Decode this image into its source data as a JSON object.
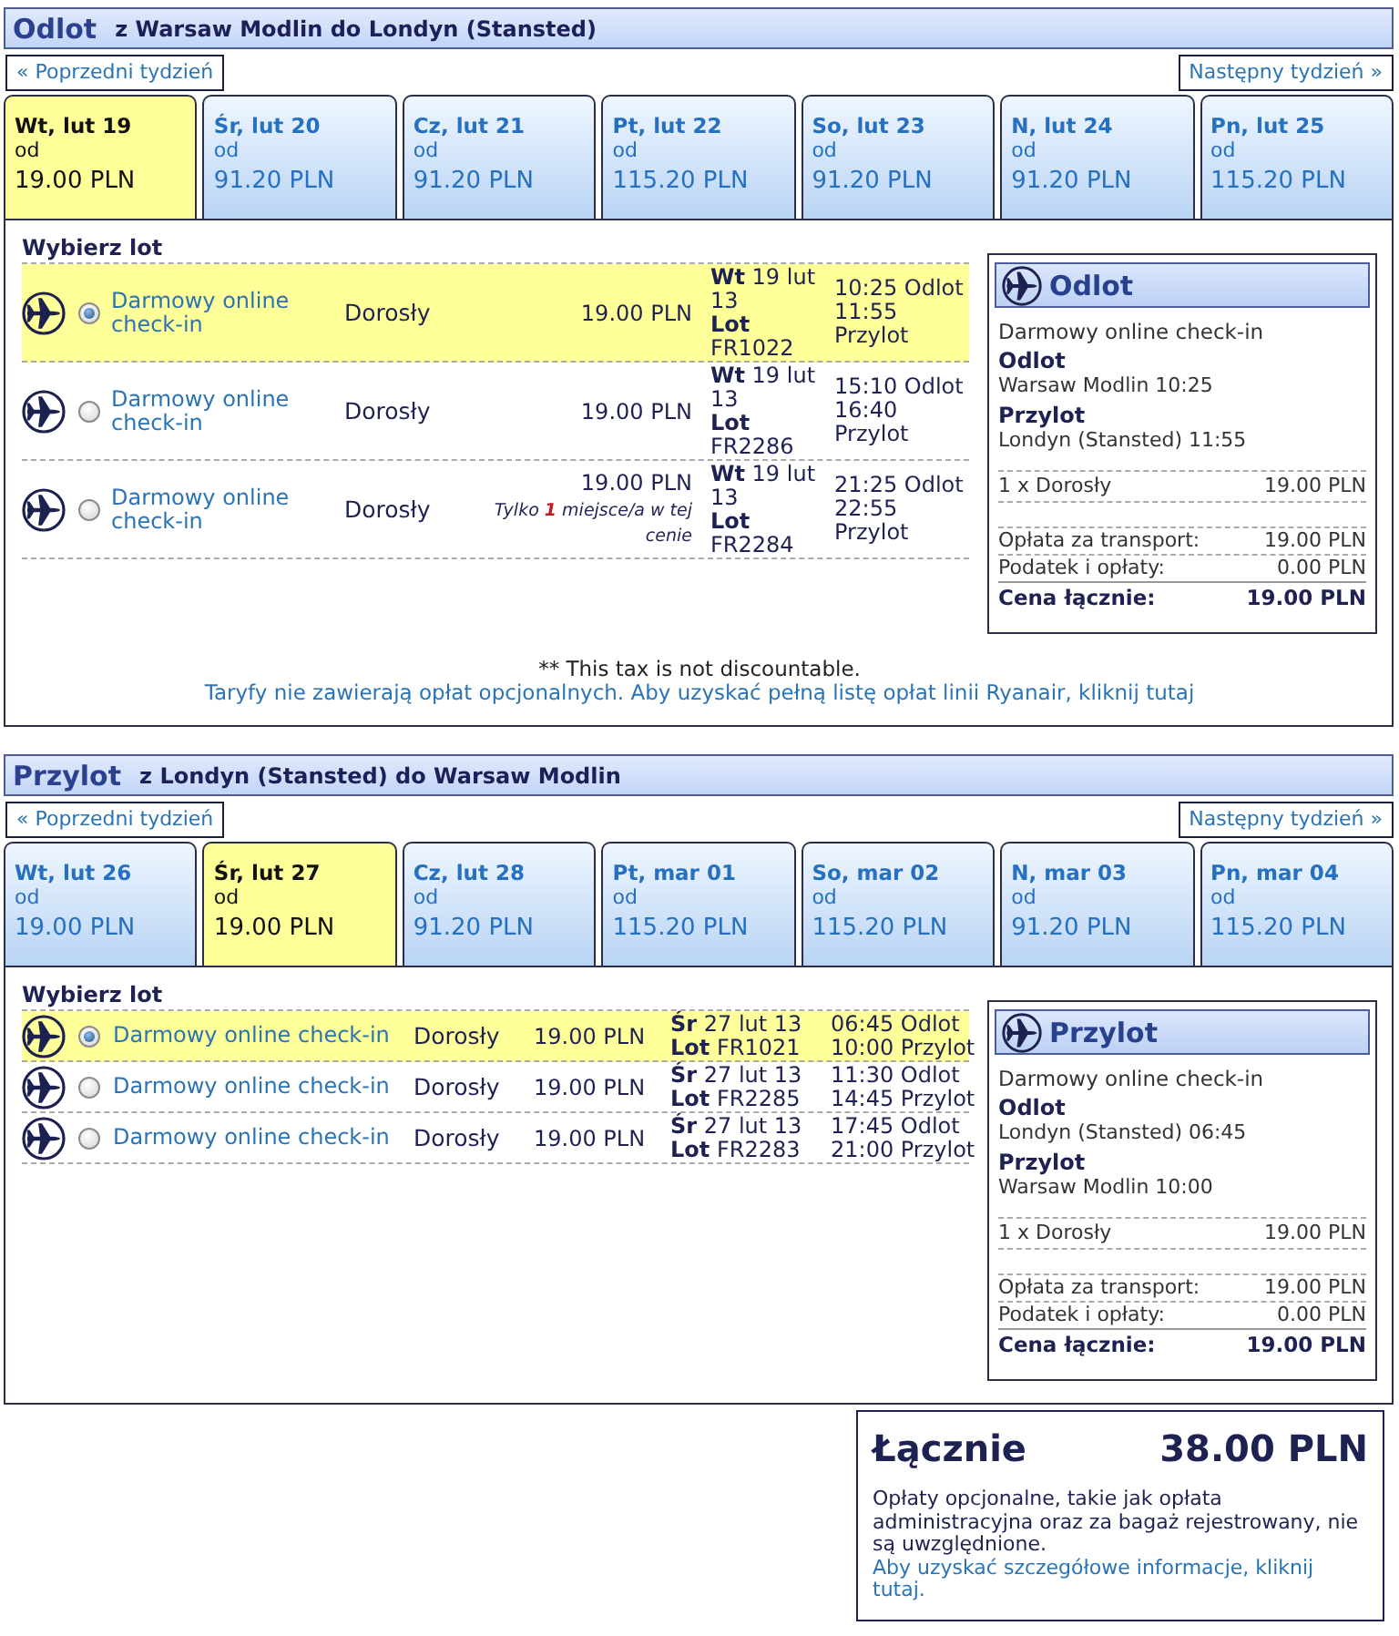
{
  "sections": [
    {
      "title": "Odlot",
      "route": "z Warsaw Modlin do Londyn (Stansted)",
      "prev_week": "« Poprzedni tydzień",
      "next_week": "Następny tydzień »",
      "days": [
        {
          "label": "Wt, lut 19",
          "from": "od",
          "price": "19.00 PLN",
          "selected": true
        },
        {
          "label": "Śr, lut 20",
          "from": "od",
          "price": "91.20 PLN",
          "selected": false
        },
        {
          "label": "Cz, lut 21",
          "from": "od",
          "price": "91.20 PLN",
          "selected": false
        },
        {
          "label": "Pt, lut 22",
          "from": "od",
          "price": "115.20 PLN",
          "selected": false
        },
        {
          "label": "So, lut 23",
          "from": "od",
          "price": "91.20 PLN",
          "selected": false
        },
        {
          "label": "N, lut 24",
          "from": "od",
          "price": "91.20 PLN",
          "selected": false
        },
        {
          "label": "Pn, lut 25",
          "from": "od",
          "price": "115.20 PLN",
          "selected": false
        }
      ],
      "choose_label": "Wybierz lot",
      "flights": [
        {
          "checkin": "Darmowy online check-in",
          "passenger": "Dorosły",
          "price": "19.00 PLN",
          "date": "**Wt** 19 lut 13",
          "flight": "**Lot** FR1022",
          "departs": "10:25 Odlot",
          "arrives": "11:55 Przylot",
          "selected": true
        },
        {
          "checkin": "Darmowy online check-in",
          "passenger": "Dorosły",
          "price": "19.00 PLN",
          "date": "**Wt** 19 lut 13",
          "flight": "**Lot** FR2286",
          "departs": "15:10 Odlot",
          "arrives": "16:40 Przylot",
          "selected": false
        },
        {
          "checkin": "Darmowy online check-in",
          "passenger": "Dorosły",
          "price": "19.00 PLN",
          "note": "Tylko **1** miejsce/a w tej cenie",
          "date": "**Wt** 19 lut 13",
          "flight": "**Lot** FR2284",
          "departs": "21:25 Odlot",
          "arrives": "22:55 Przylot",
          "selected": false
        }
      ],
      "summary": {
        "title": "Odlot",
        "checkin": "Darmowy online check-in",
        "legs": [
          {
            "label": "Odlot",
            "value": "Warsaw Modlin 10:25"
          },
          {
            "label": "Przylot",
            "value": "Londyn (Stansted) 11:55"
          }
        ],
        "passengers": [
          {
            "label": "1 x Dorosły",
            "amount": "19.00 PLN"
          }
        ],
        "charges": [
          {
            "label": "Opłata za transport:",
            "amount": "19.00 PLN"
          },
          {
            "label": "Podatek i opłaty:",
            "amount": "0.00 PLN"
          }
        ],
        "total": {
          "label": "Cena łącznie:",
          "amount": "19.00 PLN"
        }
      },
      "footnote": "** This tax is not discountable.",
      "fees_link": "Taryfy nie zawierają opłat opcjonalnych. Aby uzyskać pełną listę opłat linii Ryanair, kliknij tutaj"
    },
    {
      "title": "Przylot",
      "route": "z Londyn (Stansted) do Warsaw Modlin",
      "prev_week": "« Poprzedni tydzień",
      "next_week": "Następny tydzień »",
      "days": [
        {
          "label": "Wt, lut 26",
          "from": "od",
          "price": "19.00 PLN",
          "selected": false
        },
        {
          "label": "Śr, lut 27",
          "from": "od",
          "price": "19.00 PLN",
          "selected": true
        },
        {
          "label": "Cz, lut 28",
          "from": "od",
          "price": "91.20 PLN",
          "selected": false
        },
        {
          "label": "Pt, mar 01",
          "from": "od",
          "price": "115.20 PLN",
          "selected": false
        },
        {
          "label": "So, mar 02",
          "from": "od",
          "price": "115.20 PLN",
          "selected": false
        },
        {
          "label": "N, mar 03",
          "from": "od",
          "price": "91.20 PLN",
          "selected": false
        },
        {
          "label": "Pn, mar 04",
          "from": "od",
          "price": "115.20 PLN",
          "selected": false
        }
      ],
      "choose_label": "Wybierz lot",
      "flights": [
        {
          "checkin": "Darmowy online check-in",
          "passenger": "Dorosły",
          "price": "19.00 PLN",
          "date": "**Śr** 27 lut 13",
          "flight": "**Lot** FR1021",
          "departs": "06:45 Odlot",
          "arrives": "10:00 Przylot",
          "selected": true
        },
        {
          "checkin": "Darmowy online check-in",
          "passenger": "Dorosły",
          "price": "19.00 PLN",
          "date": "**Śr** 27 lut 13",
          "flight": "**Lot** FR2285",
          "departs": "11:30 Odlot",
          "arrives": "14:45 Przylot",
          "selected": false
        },
        {
          "checkin": "Darmowy online check-in",
          "passenger": "Dorosły",
          "price": "19.00 PLN",
          "date": "**Śr** 27 lut 13",
          "flight": "**Lot** FR2283",
          "departs": "17:45 Odlot",
          "arrives": "21:00 Przylot",
          "selected": false
        }
      ],
      "summary": {
        "title": "Przylot",
        "checkin": "Darmowy online check-in",
        "legs": [
          {
            "label": "Odlot",
            "value": "Londyn (Stansted) 06:45"
          },
          {
            "label": "Przylot",
            "value": "Warsaw Modlin 10:00"
          }
        ],
        "passengers": [
          {
            "label": "1 x Dorosły",
            "amount": "19.00 PLN"
          }
        ],
        "charges": [
          {
            "label": "Opłata za transport:",
            "amount": "19.00 PLN"
          },
          {
            "label": "Podatek i opłaty:",
            "amount": "0.00 PLN"
          }
        ],
        "total": {
          "label": "Cena łącznie:",
          "amount": "19.00 PLN"
        }
      }
    }
  ],
  "total": {
    "label": "Łącznie",
    "amount": "38.00 PLN",
    "note": "Opłaty opcjonalne, takie jak opłata administracyjna oraz za bagaż rejestrowany, nie są uwzględnione.",
    "link": "Aby uzyskać szczegółowe informacje, kliknij tutaj."
  }
}
